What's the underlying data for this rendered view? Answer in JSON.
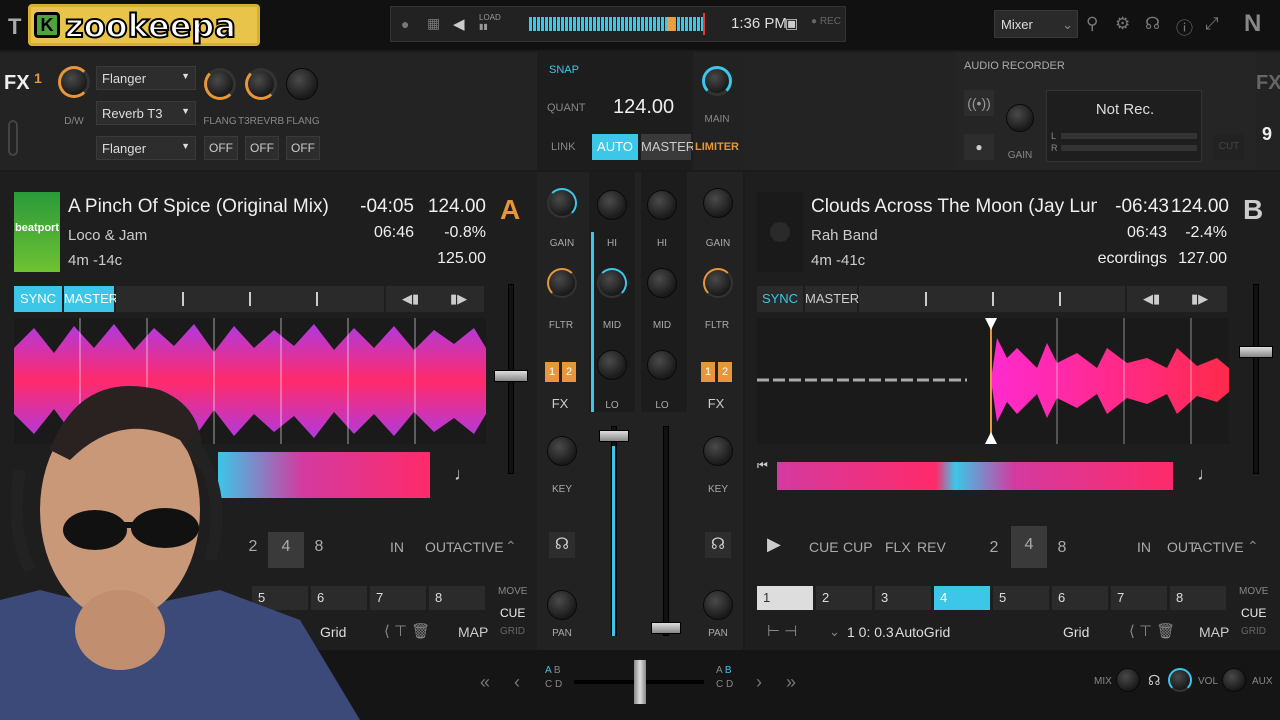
{
  "topbar": {
    "logo_letter": "K",
    "logo_text": "zookeepa",
    "clock": "1:36 PM",
    "layout_select": "Mixer",
    "left_letter": "T",
    "brand": "N"
  },
  "fx": {
    "label": "FX",
    "unit": "1",
    "dw_label": "D/W",
    "selects": [
      "Flanger",
      "Reverb T3",
      "Flanger"
    ],
    "knob_labels": [
      "FLANG",
      "T3REVRB",
      "FLANG"
    ],
    "off_labels": [
      "OFF",
      "OFF",
      "OFF"
    ]
  },
  "center_top": {
    "snap": "SNAP",
    "quant": "QUANT",
    "bpm": "124.00",
    "link": "LINK",
    "auto": "AUTO",
    "master": "MASTER",
    "main": "MAIN",
    "limiter": "LIMITER"
  },
  "recorder": {
    "title": "AUDIO RECORDER",
    "status": "Not Rec.",
    "gain": "GAIN",
    "cut": "CUT",
    "l": "L",
    "r": "R"
  },
  "deckA": {
    "title": "A Pinch Of Spice (Original Mix)",
    "artist": "Loco & Jam",
    "key_info": "4m -14c",
    "remaining": "-04:05",
    "length": "06:46",
    "bpm": "124.00",
    "pitch": "-0.8%",
    "orig_bpm": "125.00",
    "letter": "A",
    "sync": "SYNC",
    "master": "MASTER",
    "loop_sizes": [
      "2",
      "4",
      "8"
    ],
    "in": "IN",
    "out": "OUT",
    "active": "ACTIVE",
    "cues": [
      "5",
      "6",
      "7",
      "8"
    ],
    "move": "MOVE",
    "cue": "CUE",
    "grid": "GRID",
    "grid_sel": "Grid",
    "map": "MAP"
  },
  "deckB": {
    "title": "Clouds Across The Moon (Jay Lumen And U",
    "artist": "Rah Band",
    "key_info": "4m -41c",
    "remaining": "-06:43",
    "length": "06:43",
    "bpm": "124.00",
    "pitch": "-2.4%",
    "orig_bpm": "127.00",
    "comment": "ecordings",
    "letter": "B",
    "sync": "SYNC",
    "master": "MASTER",
    "cue_btn": "CUE",
    "cup": "CUP",
    "flx": "FLX",
    "rev": "REV",
    "loop_sizes": [
      "2",
      "4",
      "8"
    ],
    "in": "IN",
    "out": "OUT",
    "active": "ACTIVE",
    "cues": [
      "1",
      "2",
      "3",
      "4",
      "5",
      "6",
      "7",
      "8"
    ],
    "move": "MOVE",
    "cue": "CUE",
    "grid": "GRID",
    "beat_pos": "1 0: 0.3",
    "autogrid": "AutoGrid",
    "grid_sel": "Grid",
    "map": "MAP"
  },
  "mixer": {
    "gain": "GAIN",
    "hi": "HI",
    "mid": "MID",
    "lo": "LO",
    "fltr": "FLTR",
    "fx": "FX",
    "key": "KEY",
    "pan": "PAN",
    "fx1": "1",
    "fx2": "2"
  },
  "bottom": {
    "a": "A",
    "b": "B",
    "c": "C",
    "d": "D",
    "mix": "MIX",
    "vol": "VOL",
    "aux": "AUX"
  },
  "colors": {
    "accent": "#3cc6e8",
    "orange": "#e8963a",
    "waveA": "#e8347a",
    "waveB": "#d43aa0"
  }
}
